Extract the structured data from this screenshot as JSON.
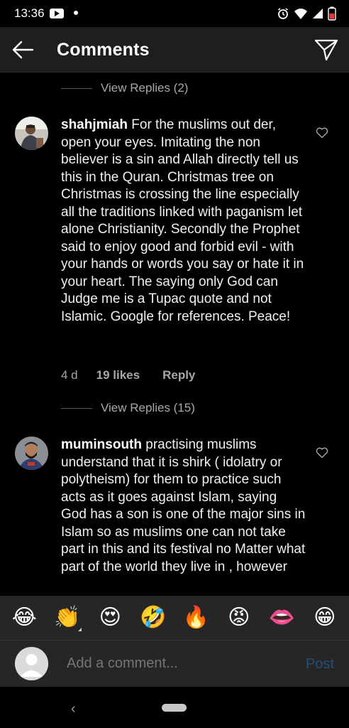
{
  "status_bar": {
    "time": "13:36",
    "icons": [
      "youtube-icon",
      "notification-dot",
      "alarm-icon",
      "wifi-icon",
      "signal-icon",
      "battery-icon"
    ]
  },
  "header": {
    "title": "Comments",
    "back_icon": "arrow-left-icon",
    "share_icon": "send-icon"
  },
  "feed": {
    "top_view_replies": "View Replies (2)",
    "comments": [
      {
        "username": "shahjmiah",
        "text": "For the muslims out der, open your eyes. Imitating the non believer is a sin and Allah directly tell us this in the Quran. Christmas tree on Christmas is crossing the line especially all the traditions linked with paganism let alone Christianity. Secondly the Prophet said to enjoy good and forbid evil - with your hands or words you say or hate it in your heart. The saying only God can Judge me is a Tupac quote and not Islamic. Google for references. Peace!",
        "time": "4 d",
        "likes": "19 likes",
        "reply": "Reply",
        "view_replies": "View Replies (15)"
      },
      {
        "username": "muminsouth",
        "text": "practising muslims understand that it is shirk ( idolatry or polytheism) for them to practice such acts as it goes against Islam, saying God has a  son is one of the major sins in Islam so as muslims one can not take part in this and its festival no Matter what part of the world they live in , however"
      }
    ]
  },
  "emoji_bar": [
    "😂",
    "👏",
    "😍",
    "🤣",
    "🔥",
    "😡",
    "👄",
    "😁"
  ],
  "composer": {
    "placeholder": "Add a comment...",
    "post_label": "Post"
  },
  "nav": {
    "back_glyph": "‹"
  },
  "colors": {
    "background": "#000000",
    "header_bg": "#1e1e1e",
    "composer_bg": "#262626",
    "post_disabled": "#214f78",
    "secondary_text": "#a8a8a8"
  }
}
